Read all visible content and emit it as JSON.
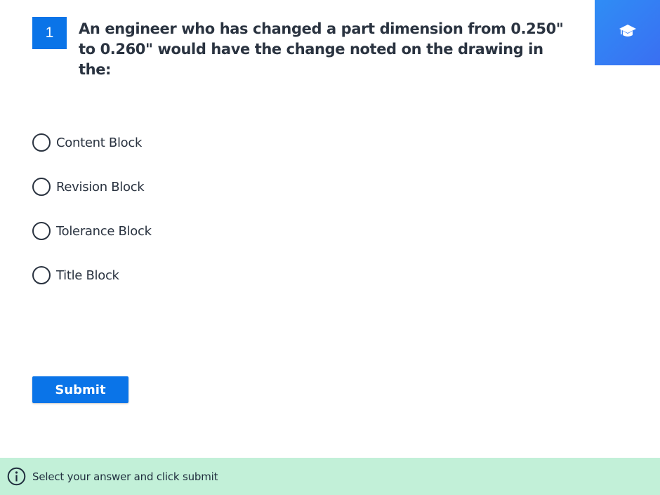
{
  "question": {
    "number": "1",
    "text": "An engineer who has changed a part dimension from 0.250\" to 0.260\" would have the change noted on the drawing in the:"
  },
  "brand": {
    "icon": "graduation-cap-icon",
    "color": "#2f8df5"
  },
  "options": [
    {
      "label": "Content Block",
      "selected": false
    },
    {
      "label": "Revision Block",
      "selected": false
    },
    {
      "label": "Tolerance Block",
      "selected": false
    },
    {
      "label": "Title Block",
      "selected": false
    }
  ],
  "submit": {
    "label": "Submit",
    "color": "#0a74e8"
  },
  "footer": {
    "icon": "info-icon",
    "text": "Select your answer and click submit",
    "background": "#c2f0d8"
  }
}
